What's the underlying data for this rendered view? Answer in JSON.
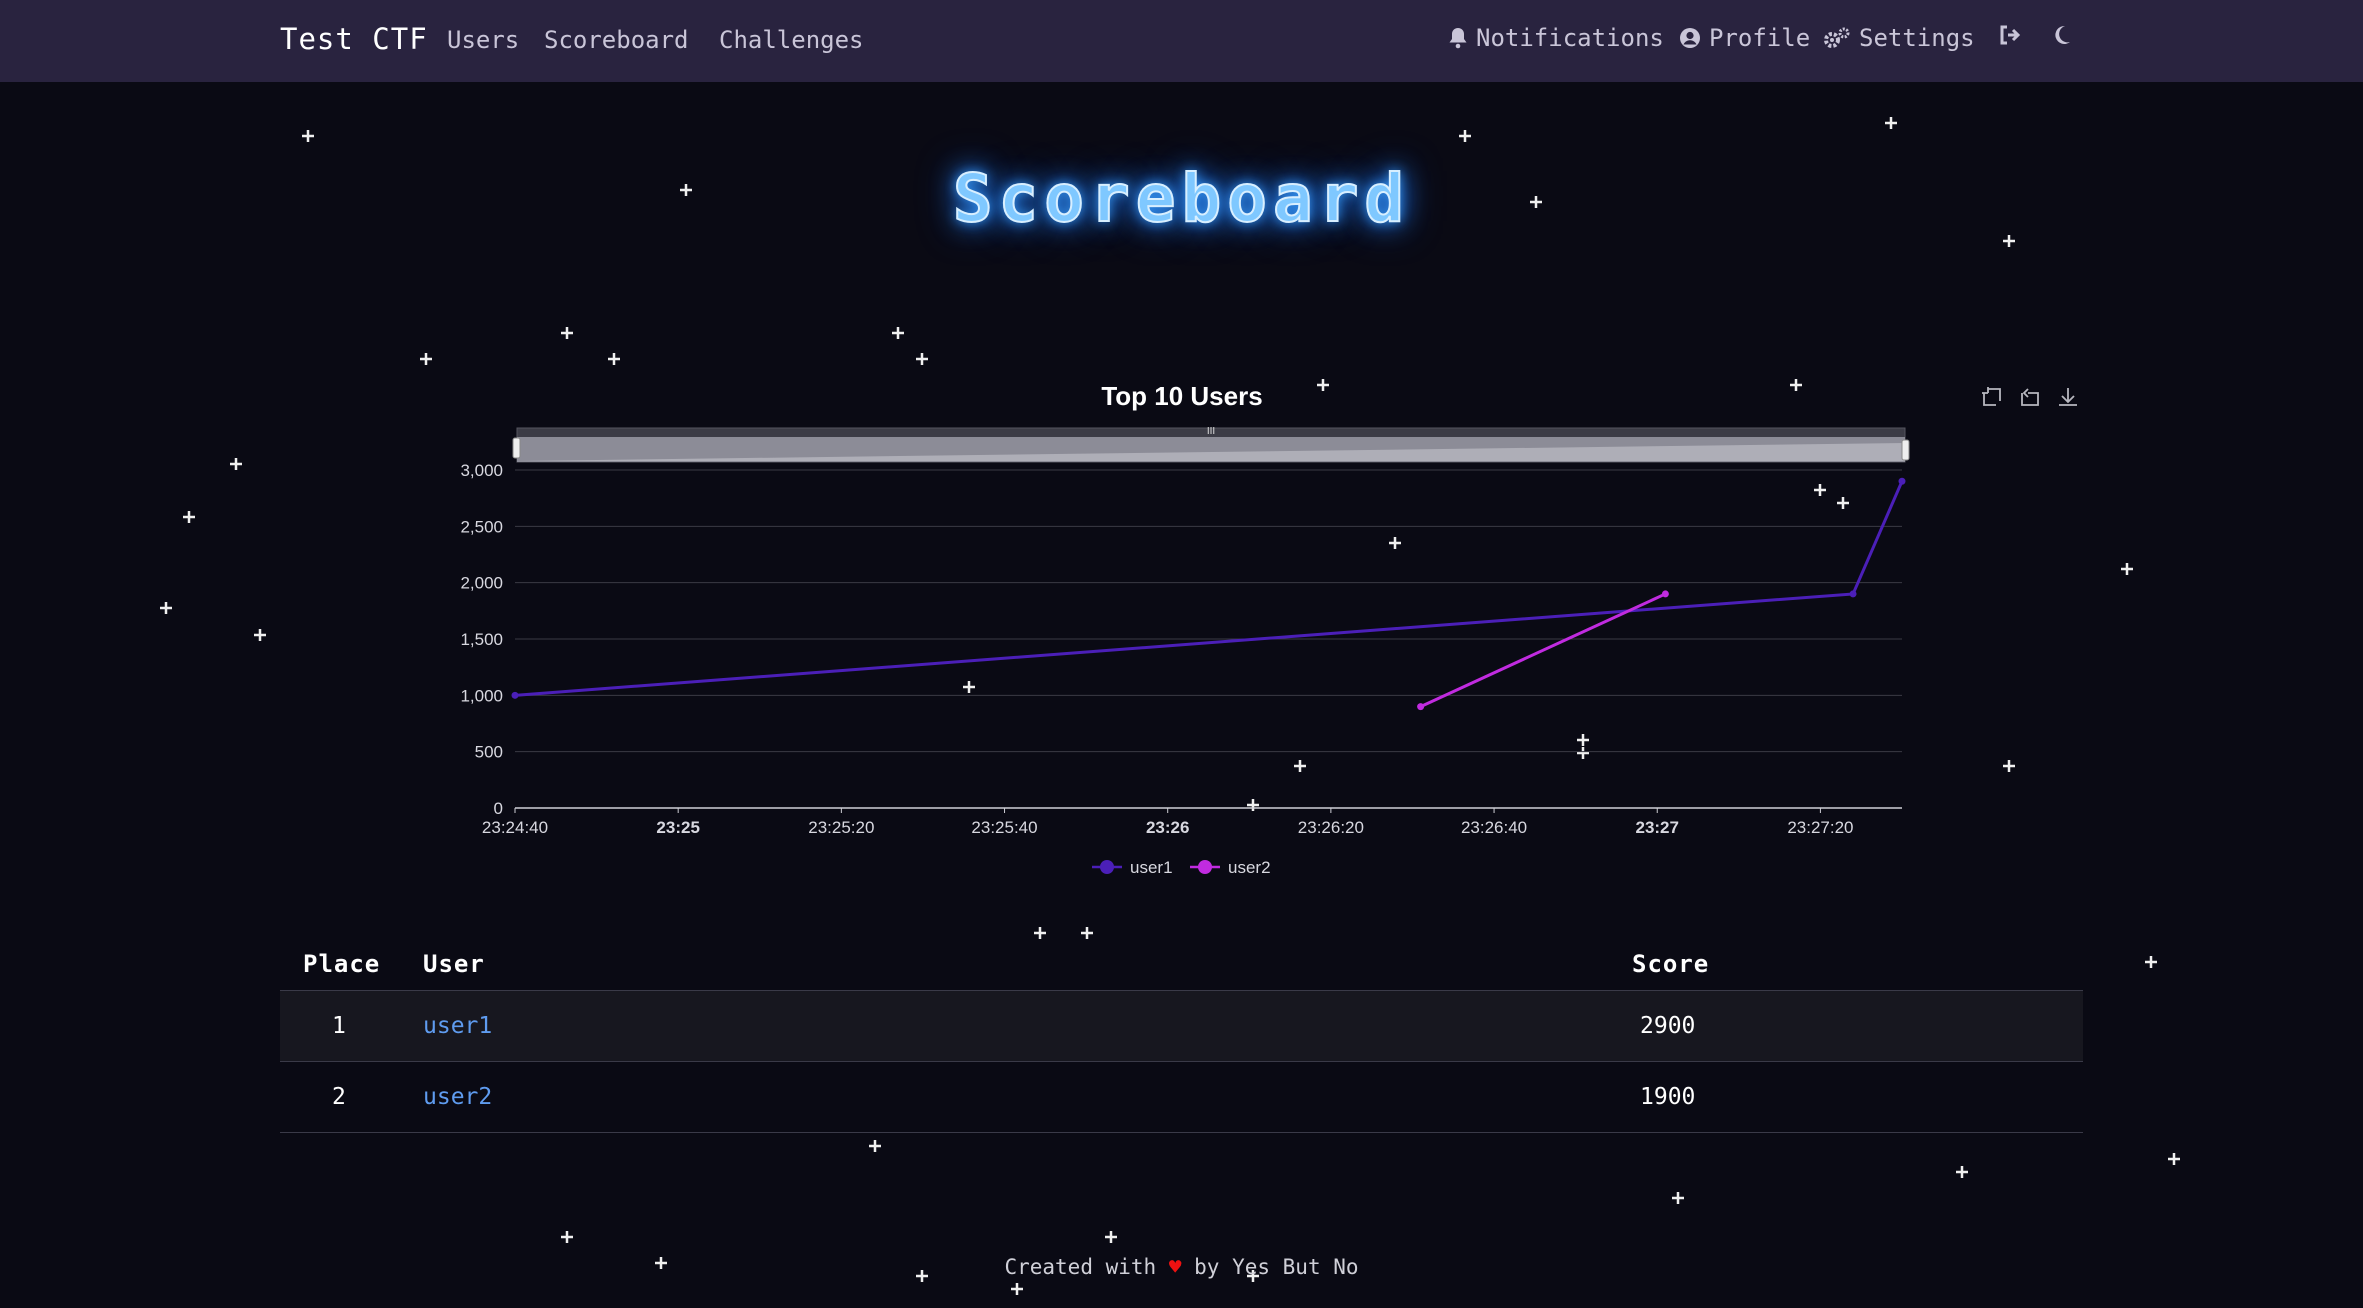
{
  "navbar": {
    "brand": "Test CTF",
    "links": [
      "Users",
      "Scoreboard",
      "Challenges"
    ],
    "notifications_label": "Notifications",
    "profile_label": "Profile",
    "settings_label": "Settings",
    "icons": [
      "bell-icon",
      "user-circle-icon",
      "gears-icon",
      "logout-icon",
      "moon-icon"
    ]
  },
  "page": {
    "title": "Scoreboard"
  },
  "chart_data": {
    "type": "line",
    "title": "Top 10 Users",
    "xlabel": "",
    "ylabel": "",
    "x_ticks": [
      "23:24:40",
      "23:25",
      "23:25:20",
      "23:25:40",
      "23:26",
      "23:26:20",
      "23:26:40",
      "23:27",
      "23:27:20"
    ],
    "x_ticks_bold": [
      false,
      true,
      false,
      false,
      true,
      false,
      false,
      true,
      false
    ],
    "x_range": [
      "23:24:40",
      "23:27:30"
    ],
    "ylim": [
      0,
      3000
    ],
    "y_ticks": [
      "0",
      "500",
      "1,000",
      "1,500",
      "2,000",
      "2,500",
      "3,000"
    ],
    "grid": true,
    "legend_position": "bottom",
    "series": [
      {
        "name": "user1",
        "color": "#4b1fb8",
        "points": [
          {
            "x": "23:24:40",
            "y": 1000
          },
          {
            "x": "23:27:24",
            "y": 1900
          },
          {
            "x": "23:27:30",
            "y": 2900
          }
        ]
      },
      {
        "name": "user2",
        "color": "#c12be0",
        "points": [
          {
            "x": "23:26:31",
            "y": 900
          },
          {
            "x": "23:27:01",
            "y": 1900
          }
        ]
      }
    ],
    "toolbox": [
      "zoom-icon",
      "zoom-reset-icon",
      "download-icon"
    ]
  },
  "table": {
    "headers": {
      "place": "Place",
      "user": "User",
      "score": "Score"
    },
    "rows": [
      {
        "place": "1",
        "user": "user1",
        "score": "2900"
      },
      {
        "place": "2",
        "user": "user2",
        "score": "1900"
      }
    ]
  },
  "footer": {
    "prefix": "Created with",
    "heart": "♥",
    "suffix": "by Yes But No"
  },
  "colors": {
    "background": "#0a0a14",
    "navbar": "#29233f",
    "link": "#5f9cf0",
    "title_glow": "#3aa0ff"
  }
}
